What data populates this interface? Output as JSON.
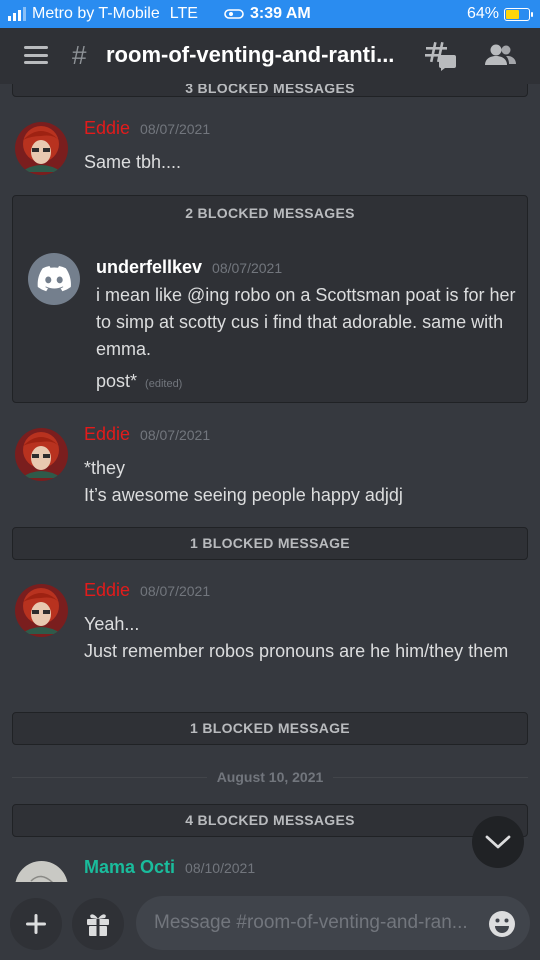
{
  "status_bar": {
    "carrier": "Metro by T-Mobile",
    "network": "LTE",
    "time": "3:39 AM",
    "battery_percent": "64%",
    "battery_level": 0.64
  },
  "header": {
    "hash": "#",
    "channel_name": "room-of-venting-and-ranti..."
  },
  "messages": {
    "top_blocked_partial": "3 BLOCKED MESSAGES",
    "m1": {
      "author": "Eddie",
      "timestamp": "08/07/2021",
      "lines": [
        "Same tbh...."
      ]
    },
    "blocked_expanded_label": "2 BLOCKED MESSAGES",
    "blocked_msg": {
      "author": "underfellkev",
      "timestamp": "08/07/2021",
      "text": "i mean like @ing robo on a Scottsman poat is for her to simp at scotty cus i find that adorable. same with emma.",
      "edit_text": "post*",
      "edited_label": "(edited)"
    },
    "m2": {
      "author": "Eddie",
      "timestamp": "08/07/2021",
      "lines": [
        "*they",
        "It’s awesome seeing people happy adjdj"
      ]
    },
    "blocked_2": "1 BLOCKED MESSAGE",
    "m3": {
      "author": "Eddie",
      "timestamp": "08/07/2021",
      "lines": [
        "Yeah...",
        "Just remember robos pronouns are he him/they them"
      ]
    },
    "blocked_3": "1 BLOCKED MESSAGE",
    "date_separator": "August 10, 2021",
    "blocked_4": "4 BLOCKED MESSAGES",
    "m4": {
      "author": "Mama Octi",
      "timestamp": "08/10/2021"
    }
  },
  "colors": {
    "eddie_name": "#e31b1b",
    "mama_octi_name": "#1abc9c",
    "status_bar": "#2a8cf0",
    "discord_blurple": "#5865f2"
  },
  "input": {
    "placeholder": "Message #room-of-venting-and-ran..."
  },
  "icons": {
    "menu": "hamburger-icon",
    "threads": "threads-icon",
    "members": "members-icon",
    "add": "plus-icon",
    "gift": "gift-icon",
    "emoji": "emoji-icon",
    "jump": "chevron-down-icon"
  }
}
